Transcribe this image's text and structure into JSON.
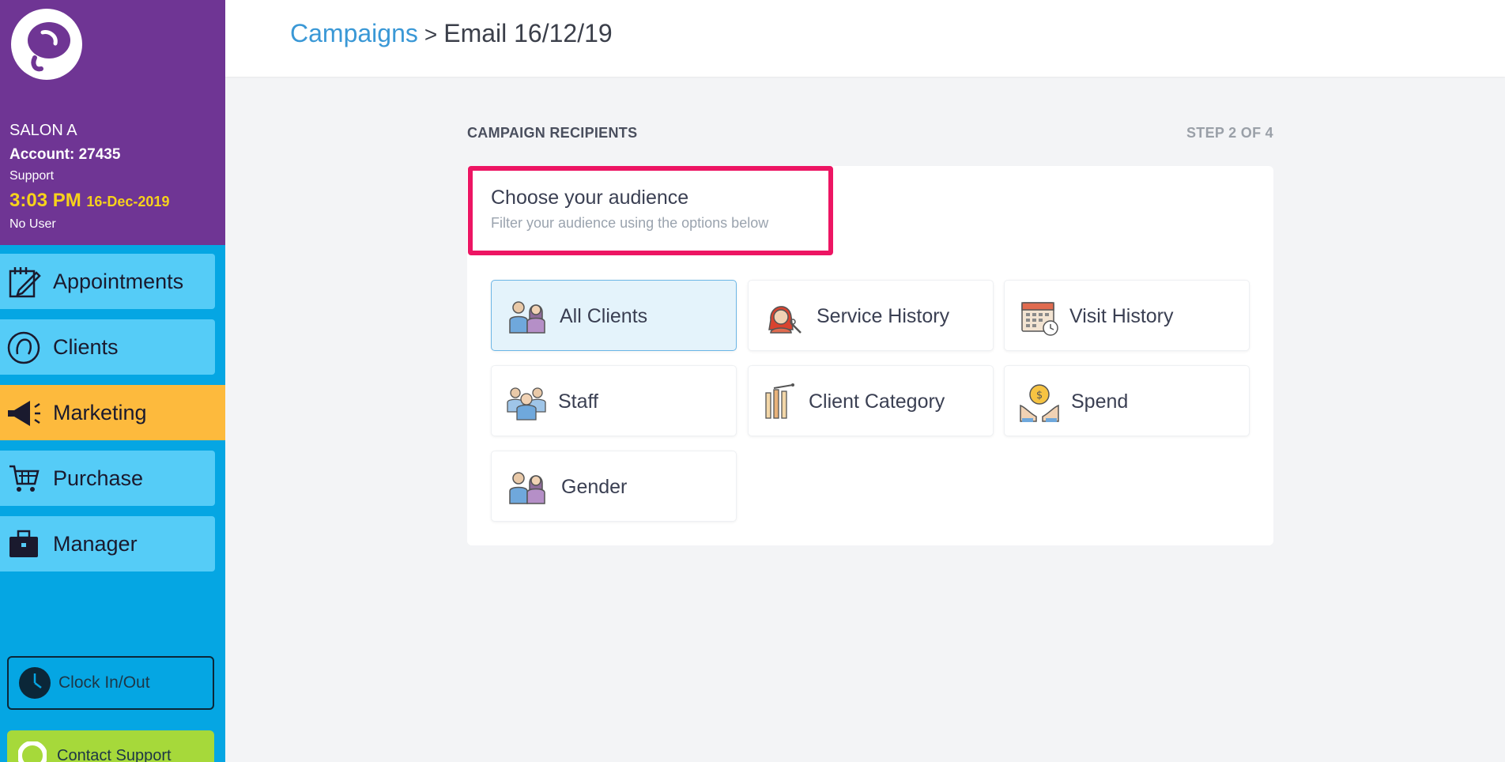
{
  "sidebar": {
    "salon_name": "SALON A",
    "account": "Account: 27435",
    "support": "Support",
    "time": "3:03 PM",
    "date": "16-Dec-2019",
    "user": "No User",
    "nav": [
      {
        "label": "Appointments",
        "icon": "appointment-icon",
        "active": false
      },
      {
        "label": "Clients",
        "icon": "client-icon",
        "active": false
      },
      {
        "label": "Marketing",
        "icon": "megaphone-icon",
        "active": true
      },
      {
        "label": "Purchase",
        "icon": "cart-icon",
        "active": false
      },
      {
        "label": "Manager",
        "icon": "briefcase-icon",
        "active": false
      }
    ],
    "clock_label": "Clock In/Out",
    "support_label": "Contact Support"
  },
  "breadcrumb": {
    "parent": "Campaigns",
    "separator": ">",
    "current": "Email 16/12/19"
  },
  "main": {
    "section_title": "CAMPAIGN RECIPIENTS",
    "step": "STEP 2 OF 4",
    "audience_title": "Choose your audience",
    "audience_subtitle": "Filter your audience using the options below",
    "options": [
      {
        "label": "All Clients",
        "icon": "people-icon",
        "selected": true
      },
      {
        "label": "Service History",
        "icon": "hairdresser-icon",
        "selected": false
      },
      {
        "label": "Visit History",
        "icon": "calendar-icon",
        "selected": false
      },
      {
        "label": "Staff",
        "icon": "staff-group-icon",
        "selected": false
      },
      {
        "label": "Client Category",
        "icon": "category-tools-icon",
        "selected": false
      },
      {
        "label": "Spend",
        "icon": "coin-hands-icon",
        "selected": false
      },
      {
        "label": "Gender",
        "icon": "gender-people-icon",
        "selected": false
      }
    ]
  },
  "colors": {
    "sidebar_header": "#6f3594",
    "sidebar_bg": "#05a6e3",
    "nav_item": "#55ccf7",
    "nav_active": "#fdba3d",
    "accent_link": "#3a98d6",
    "highlight_border": "#ed1563",
    "time_yellow": "#f7d21b",
    "support_green": "#a6d93a"
  }
}
